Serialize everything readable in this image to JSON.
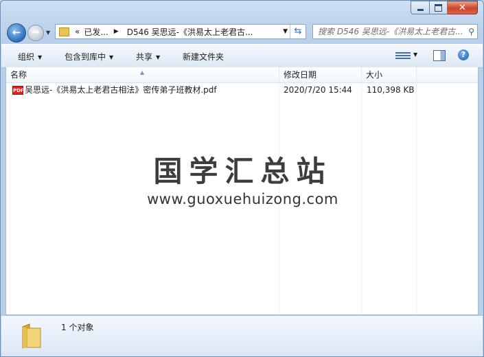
{
  "window": {
    "caption_buttons": {
      "minimize_icon": "minimize-icon",
      "maximize_icon": "maximize-icon",
      "close_label": "✕"
    }
  },
  "nav": {
    "back_icon": "back-arrow-icon",
    "forward_icon": "forward-arrow-icon",
    "history_dropdown_icon": "chevron-down-icon"
  },
  "address": {
    "overflow": "«",
    "crumbs": [
      "已发...",
      "D546 吴思远-《洪易太上老君古..."
    ],
    "refresh_icon": "refresh-icon"
  },
  "search": {
    "placeholder": "搜索 D546 吴思远-《洪易太上老君古...",
    "icon": "search-icon"
  },
  "toolbar": {
    "organize": "组织",
    "include_library": "包含到库中",
    "share": "共享",
    "new_folder": "新建文件夹",
    "view_icon": "view-options-icon",
    "pane_icon": "preview-pane-icon",
    "help_label": "?"
  },
  "columns": {
    "name": "名称",
    "date_modified": "修改日期",
    "size": "大小"
  },
  "files": [
    {
      "icon": "pdf-file-icon",
      "icon_label": "PDF",
      "name": "吴思远-《洪易太上老君古相法》密传弟子班教材.pdf",
      "date_modified": "2020/7/20 15:44",
      "size": "110,398 KB"
    }
  ],
  "watermark": {
    "title": "国学汇总站",
    "url": "www.guoxuehuizong.com"
  },
  "details": {
    "status": "1 个对象",
    "icon": "folder-icon"
  },
  "colors": {
    "close_button": "#c8462e",
    "pdf_icon": "#cf2a25",
    "accent": "#2f6fb9"
  }
}
